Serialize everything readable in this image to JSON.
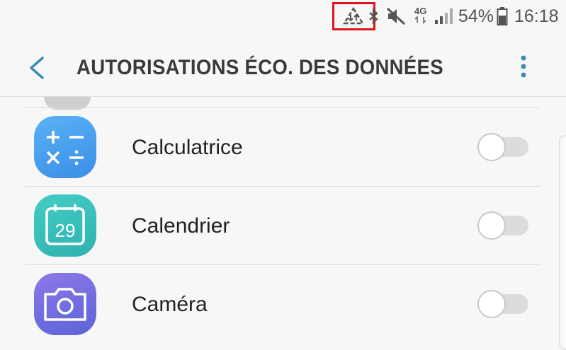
{
  "status_bar": {
    "battery_percent": "54%",
    "time": "16:18",
    "network_type": "4G",
    "icons": [
      "data-saver-icon",
      "bluetooth-icon",
      "mute-icon",
      "network-4g-icon",
      "signal-icon",
      "battery-icon"
    ],
    "highlight_color": "#e0141e"
  },
  "app_bar": {
    "title": "AUTORISATIONS ÉCO. DES DONNÉES",
    "back_icon": "back-arrow-icon",
    "more_icon": "more-vert-icon",
    "accent_color": "#3a8fb0"
  },
  "apps": [
    {
      "name": "Calculatrice",
      "icon": "calculator-icon",
      "enabled": false
    },
    {
      "name": "Calendrier",
      "icon": "calendar-icon",
      "icon_text": "29",
      "enabled": false
    },
    {
      "name": "Caméra",
      "icon": "camera-icon",
      "enabled": false
    }
  ]
}
